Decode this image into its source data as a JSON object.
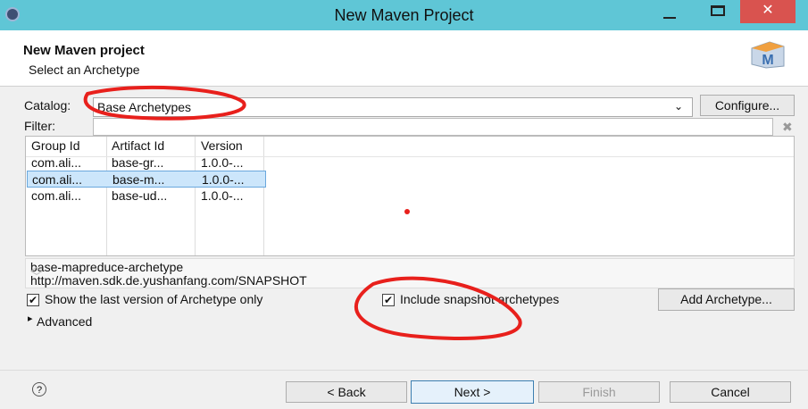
{
  "window": {
    "title": "New Maven Project",
    "close_label": "✕"
  },
  "header": {
    "title": "New Maven project",
    "subtitle": "Select an Archetype",
    "logo_letter": "M"
  },
  "catalog": {
    "label": "Catalog:",
    "value": "Base Archetypes",
    "configure_label": "Configure..."
  },
  "filter": {
    "label": "Filter:",
    "value": "",
    "clear_icon": "✖"
  },
  "table": {
    "columns": [
      "Group Id",
      "Artifact Id",
      "Version"
    ],
    "rows": [
      [
        "com.ali...",
        "base-gr...",
        "1.0.0-..."
      ],
      [
        "com.ali...",
        "base-m...",
        "1.0.0-..."
      ],
      [
        "com.ali...",
        "base-ud...",
        "1.0.0-..."
      ]
    ],
    "selected_row": 1
  },
  "description": {
    "line1": "base-mapreduce-archetype",
    "line2": "http://maven.sdk.de.yushanfang.com/SNAPSHOT"
  },
  "options": {
    "show_last_version_label": "Show the last version of Archetype only",
    "show_last_version_checked": true,
    "include_snapshot_label": "Include snapshot archetypes",
    "include_snapshot_checked": true,
    "add_archetype_label": "Add Archetype..."
  },
  "advanced": {
    "label": "Advanced",
    "arrow": "▸"
  },
  "buttons": {
    "help": "?",
    "back": "< Back",
    "next": "Next >",
    "finish": "Finish",
    "cancel": "Cancel"
  },
  "colors": {
    "titlebar": "#5fc6d6",
    "close": "#d9534f",
    "selection": "#cce6fb",
    "annotation": "#e8201c"
  }
}
